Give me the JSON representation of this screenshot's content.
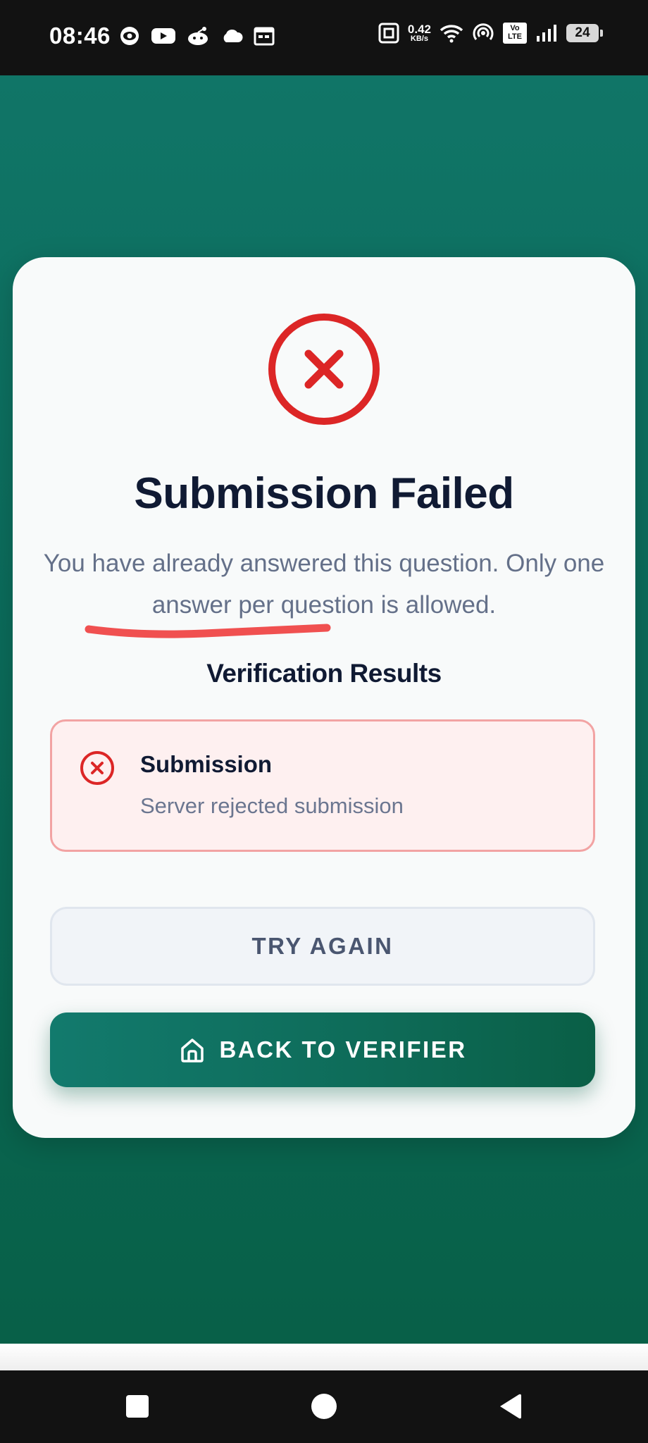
{
  "status_bar": {
    "time": "08:46",
    "left_icons": [
      "eye-icon",
      "youtube-icon",
      "reddit-icon",
      "cloud-icon",
      "calendar-icon"
    ],
    "network_speed_value": "0.42",
    "network_speed_unit": "KB/s",
    "volte_top": "Vo",
    "volte_bottom": "LTE",
    "battery_level": "24"
  },
  "card": {
    "title": "Submission Failed",
    "message": "You have already answered this question. Only one answer per question is allowed.",
    "section_title": "Verification Results",
    "results": [
      {
        "title": "Submission",
        "detail": "Server rejected submission",
        "status": "failed",
        "icon": "x-circle-icon"
      }
    ],
    "try_again_label": "TRY AGAIN",
    "back_label": "BACK TO VERIFIER",
    "back_icon": "home-icon"
  },
  "colors": {
    "error": "#dc2626",
    "primary": "#0e6b58",
    "annotation": "#f05050",
    "background": "#0b6b5a"
  },
  "nav_bar": {
    "buttons": [
      "recents-square",
      "home-circle",
      "back-triangle"
    ]
  }
}
